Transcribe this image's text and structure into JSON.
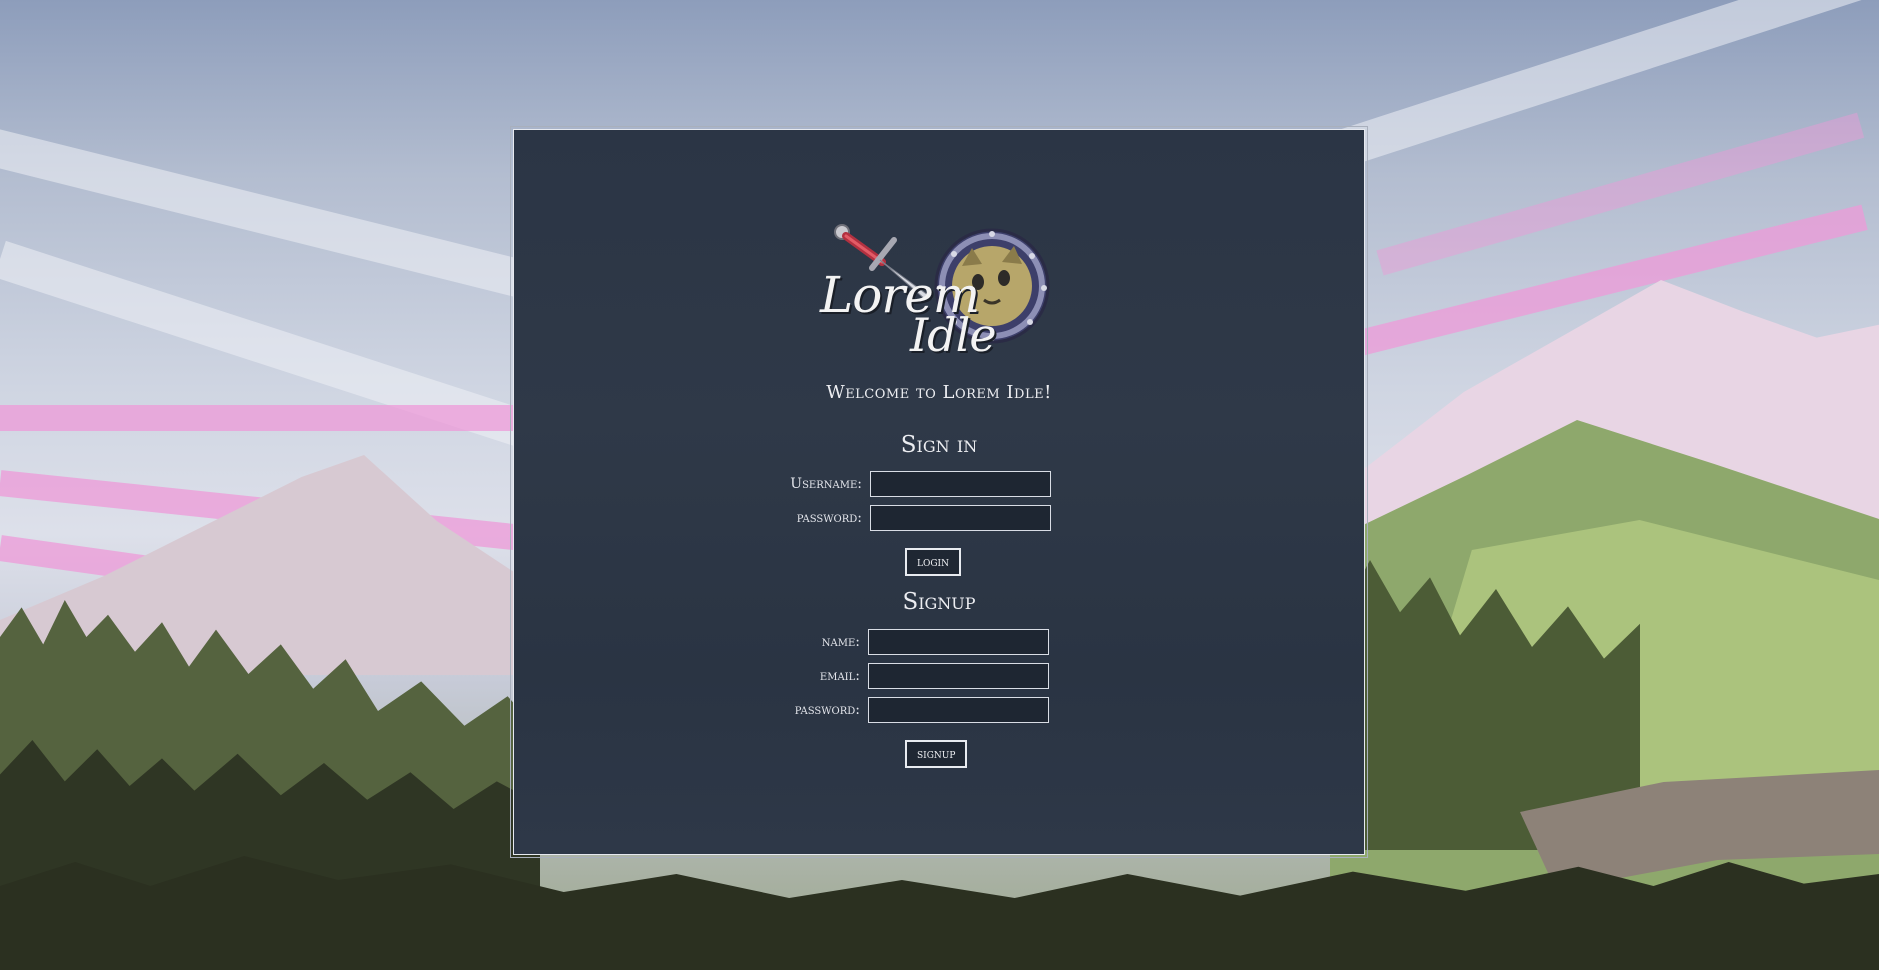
{
  "app": {
    "logo_line_1": "Lorem",
    "logo_line_2": "Idle",
    "welcome": "Welcome to Lorem Idle!"
  },
  "signin": {
    "title": "Sign in",
    "username_label": "Username:",
    "password_label": "password:",
    "username_value": "",
    "password_value": "",
    "button_label": "login"
  },
  "signup": {
    "title": "Signup",
    "name_label": "name:",
    "email_label": "email:",
    "password_label": "password:",
    "name_value": "",
    "email_value": "",
    "password_value": "",
    "button_label": "signup"
  },
  "icons": {
    "logo_sword": "sword-icon",
    "logo_shield": "cat-shield-icon"
  },
  "colors": {
    "panel_bg": "#2c3646",
    "panel_border": "#e6e9ef",
    "text": "#ecedf1",
    "input_bg": "#1e2632"
  }
}
